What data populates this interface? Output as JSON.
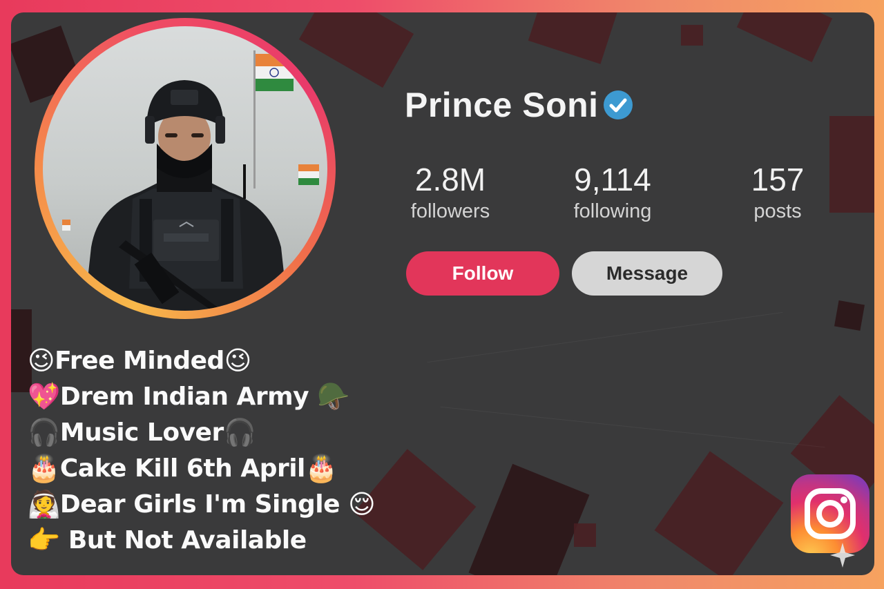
{
  "profile": {
    "name": "Prince Soni",
    "verified": true,
    "avatar_alt": "soldier-portrait"
  },
  "stats": [
    {
      "value": "2.8M",
      "label": "followers"
    },
    {
      "value": "9,114",
      "label": "following"
    },
    {
      "value": "157",
      "label": "posts"
    }
  ],
  "actions": {
    "follow_label": "Follow",
    "message_label": "Message"
  },
  "bio": [
    {
      "lead": "😉",
      "text": "Free Minded",
      "trail": "😉"
    },
    {
      "lead": "💖",
      "text": "Drem Indian Army ",
      "trail": "🪖"
    },
    {
      "lead": "🎧",
      "text": "Music Lover",
      "trail": "🎧"
    },
    {
      "lead": "🎂",
      "text": "Cake Kill 6th April",
      "trail": "🎂"
    },
    {
      "lead": "👰",
      "text": "Dear Girls I'm Single ",
      "trail": "😌"
    },
    {
      "lead": "👉",
      "text": " But Not Available",
      "trail": ""
    }
  ],
  "colors": {
    "frame_gradient": [
      "#e83a5c",
      "#f6a25f"
    ],
    "card_bg": "#3a3a3b",
    "follow_button": "#e2365a",
    "message_button": "#d6d6d6",
    "verified_badge": "#3d9ad1"
  },
  "icons": {
    "verified": "verified-check-icon",
    "brand": "instagram-logo-icon"
  }
}
